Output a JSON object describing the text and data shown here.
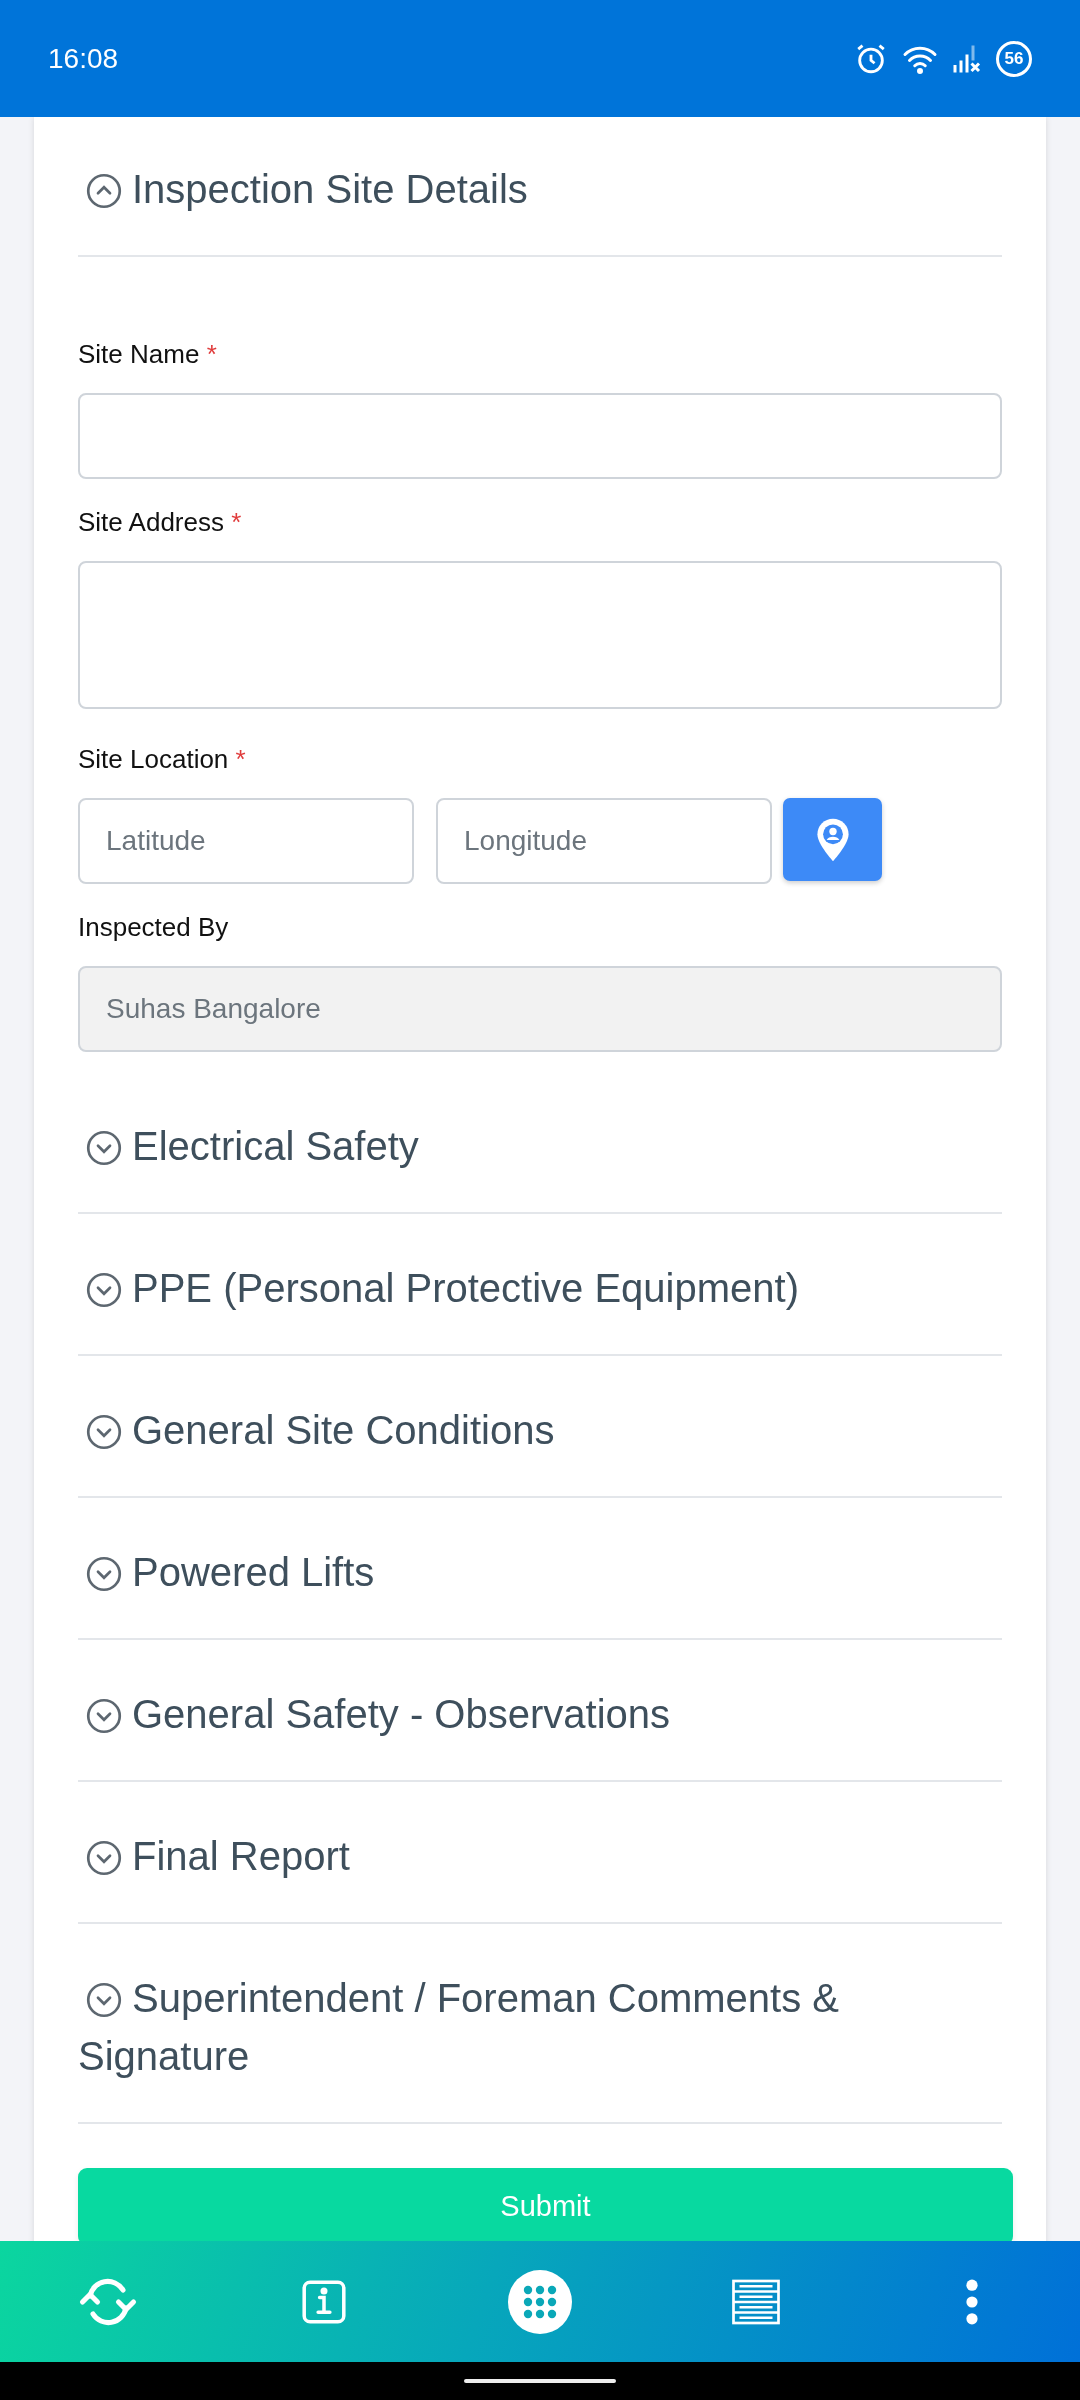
{
  "status_bar": {
    "time": "16:08",
    "battery": "56"
  },
  "sections": [
    {
      "title": "Inspection Site Details",
      "expanded": true,
      "fields": [
        {
          "kind": "text",
          "label": "Site Name",
          "required_mark": "*"
        },
        {
          "kind": "textarea",
          "label": "Site Address",
          "required_mark": "*"
        },
        {
          "kind": "location",
          "label": "Site Location",
          "required_mark": "*",
          "inputs": [
            {
              "placeholder": "Latitude"
            },
            {
              "placeholder": "Longitude"
            }
          ]
        },
        {
          "kind": "readonly",
          "label": "Inspected By",
          "value": "Suhas Bangalore"
        }
      ]
    },
    {
      "title": "Electrical Safety",
      "expanded": false
    },
    {
      "title": "PPE (Personal Protective Equipment)",
      "expanded": false
    },
    {
      "title": "General Site Conditions",
      "expanded": false
    },
    {
      "title": "Powered Lifts",
      "expanded": false
    },
    {
      "title": "General Safety - Observations",
      "expanded": false
    },
    {
      "title": "Final Report",
      "expanded": false
    },
    {
      "title": "Superintendent / Foreman Comments & Signature",
      "expanded": false
    }
  ],
  "submit": "Submit",
  "nav": [
    {
      "kind": "sync",
      "selected": false
    },
    {
      "kind": "info",
      "selected": false
    },
    {
      "kind": "apps",
      "selected": true
    },
    {
      "kind": "list",
      "selected": false
    },
    {
      "kind": "more",
      "selected": false
    }
  ]
}
